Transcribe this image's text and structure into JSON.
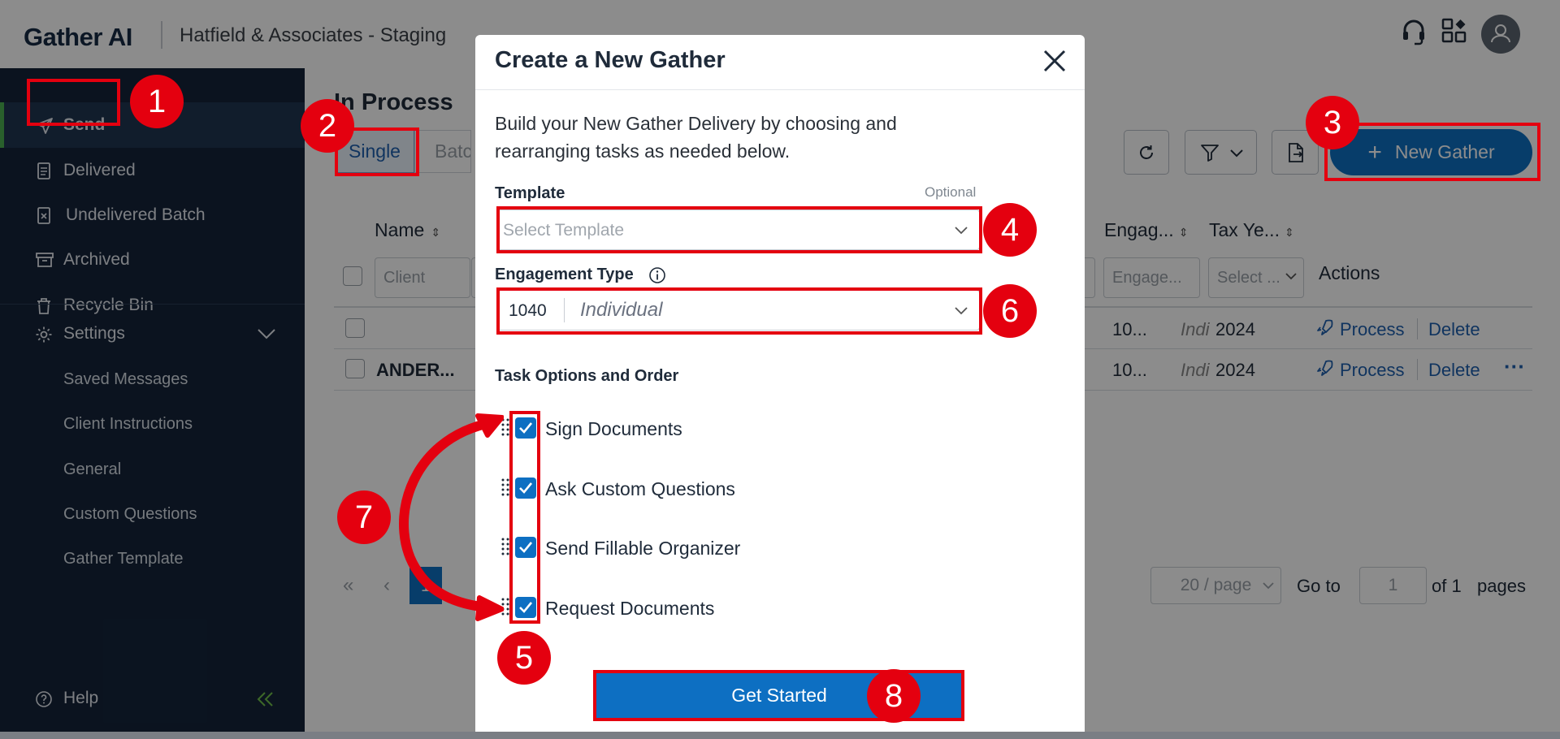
{
  "header": {
    "logo": "Gather AI",
    "firm": "Hatfield & Associates - Staging",
    "icons": [
      "headset-icon",
      "apps-grid-icon",
      "user-avatar-icon"
    ]
  },
  "sidebar": {
    "items": [
      {
        "label": "Send",
        "icon": "paper-plane-icon",
        "active": true
      },
      {
        "label": "Delivered",
        "icon": "document-icon"
      },
      {
        "label": "Undelivered Batch",
        "icon": "document-x-icon"
      },
      {
        "label": "Archived",
        "icon": "archive-box-icon"
      },
      {
        "label": "Recycle Bin",
        "icon": "trash-icon"
      }
    ],
    "settings": {
      "label": "Settings",
      "icon": "gear-icon"
    },
    "sub_items": [
      "Saved Messages",
      "Client Instructions",
      "General",
      "Custom Questions",
      "Gather Template"
    ],
    "help": {
      "label": "Help",
      "icon": "help-circle-icon"
    }
  },
  "main": {
    "heading": "In Process",
    "tabs": [
      "Single",
      "Batch"
    ],
    "new_gather_label": "New Gather",
    "columns": {
      "name": "Name",
      "engagement": "Engag...",
      "tax_year": "Tax Ye...",
      "actions": "Actions"
    },
    "filters": {
      "client_placeholder": "Client",
      "engagement_placeholder": "Engage...",
      "tax_year_placeholder": "Select ..."
    },
    "rows": [
      {
        "name": "",
        "eng_code": "10...",
        "eng_type": "Indi",
        "tax_year": "2024",
        "process": "Process",
        "delete": "Delete",
        "more": false
      },
      {
        "name": "ANDER...",
        "eng_code": "10...",
        "eng_type": "Indi",
        "tax_year": "2024",
        "process": "Process",
        "delete": "Delete",
        "more": true
      }
    ],
    "pagination": {
      "current_page": "1",
      "page_size": "20 / page",
      "goto_label": "Go to",
      "goto_value": "1",
      "of_label": "of 1",
      "pages_label": "pages"
    }
  },
  "modal": {
    "title": "Create a New Gather",
    "description": "Build your New Gather Delivery by choosing and rearranging tasks as needed below.",
    "template_label": "Template",
    "template_optional": "Optional",
    "template_placeholder": "Select Template",
    "engagement_label": "Engagement Type",
    "engagement_code": "1040",
    "engagement_value": "Individual",
    "tasks_label": "Task Options and Order",
    "tasks": [
      {
        "label": "Sign Documents",
        "checked": true
      },
      {
        "label": "Ask Custom Questions",
        "checked": true
      },
      {
        "label": "Send Fillable Organizer",
        "checked": true
      },
      {
        "label": "Request Documents",
        "checked": true
      }
    ],
    "submit_label": "Get Started"
  },
  "annotations": {
    "badges": [
      "1",
      "2",
      "3",
      "4",
      "5",
      "6",
      "7",
      "8"
    ],
    "color": "#e4000f"
  },
  "colors": {
    "accent": "#0d6fc2",
    "sidebar": "#14243a",
    "active_indicator": "#4caf50"
  }
}
